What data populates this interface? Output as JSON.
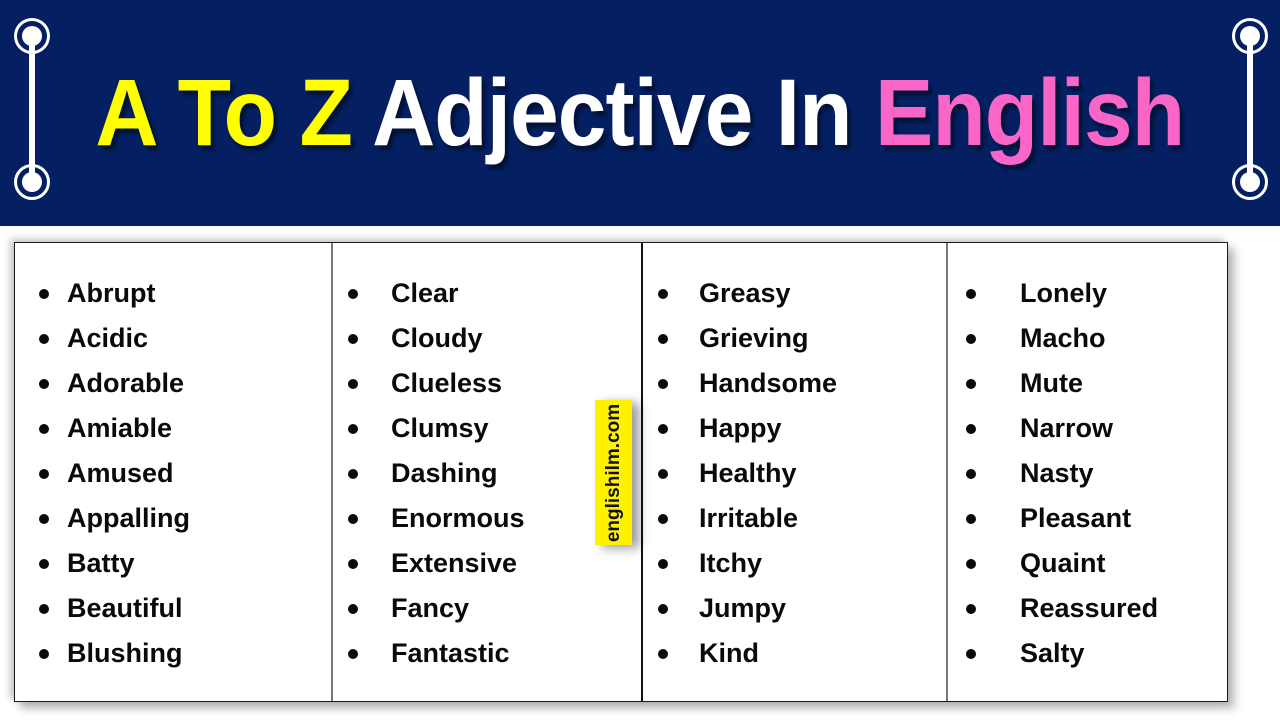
{
  "header": {
    "background_color": "#042062",
    "title_parts": [
      {
        "text": "A To Z",
        "color": "#FFFF00"
      },
      {
        "text": "Adjective In",
        "color": "#FFFFFF"
      },
      {
        "text": "English",
        "color": "#FA66C8"
      }
    ],
    "title_full": "A To Z Adjective In English",
    "title_yellow": "A To Z",
    "title_white": "Adjective In",
    "title_pink": "English",
    "decoration": "dumbbell-ornament"
  },
  "watermark": {
    "text": "englishilm.com",
    "background_color": "#FFF200",
    "text_color": "#111111"
  },
  "table": {
    "border_color": "#1a1a1a",
    "background_color": "#FFFFFF",
    "columns": [
      {
        "name": "column-1",
        "items": [
          "Abrupt",
          "Acidic",
          "Adorable",
          "Amiable",
          "Amused",
          "Appalling",
          "Batty",
          "Beautiful",
          "Blushing"
        ]
      },
      {
        "name": "column-2",
        "items": [
          "Clear",
          "Cloudy",
          "Clueless",
          "Clumsy",
          "Dashing",
          "Enormous",
          "Extensive",
          "Fancy",
          "Fantastic"
        ]
      },
      {
        "name": "column-3",
        "items": [
          "Greasy",
          "Grieving",
          "Handsome",
          "Happy",
          "Healthy",
          "Irritable",
          "Itchy",
          "Jumpy",
          "Kind"
        ]
      },
      {
        "name": "column-4",
        "items": [
          "Lonely",
          "Macho",
          "Mute",
          "Narrow",
          "Nasty",
          "Pleasant",
          "Quaint",
          "Reassured",
          "Salty"
        ]
      }
    ]
  }
}
